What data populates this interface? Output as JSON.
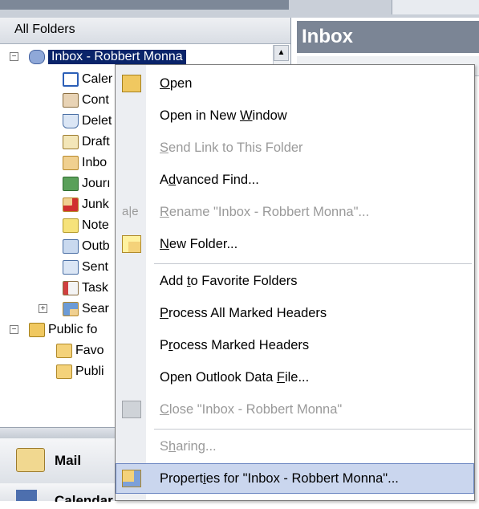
{
  "nav": {
    "header": "All Folders",
    "tree": [
      {
        "label": "Inbox - Robbert Monna",
        "icon": "mailbox-icon",
        "selected": true
      },
      {
        "label": "Calendar",
        "icon": "calendar-icon"
      },
      {
        "label": "Contacts",
        "icon": "contacts-icon"
      },
      {
        "label": "Deleted Items",
        "icon": "deleted-items-icon"
      },
      {
        "label": "Drafts",
        "icon": "drafts-icon"
      },
      {
        "label": "Inbox",
        "icon": "inbox-icon"
      },
      {
        "label": "Journal",
        "icon": "journal-icon"
      },
      {
        "label": "Junk E-mail",
        "icon": "junk-icon"
      },
      {
        "label": "Notes",
        "icon": "notes-icon"
      },
      {
        "label": "Outbox",
        "icon": "outbox-icon"
      },
      {
        "label": "Sent Items",
        "icon": "sent-icon"
      },
      {
        "label": "Tasks",
        "icon": "tasks-icon"
      },
      {
        "label": "Search Folders",
        "icon": "search-folder-icon"
      },
      {
        "label": "Public folders",
        "icon": "public-folders-icon"
      },
      {
        "label": "Favorites",
        "icon": "folder-icon"
      },
      {
        "label": "Public",
        "icon": "folder-icon"
      }
    ],
    "truncated": [
      "Inbox - Robbert Monna",
      "Caler",
      "Cont",
      "Delet",
      "Draft",
      "Inbo",
      "Jourı",
      "Junk",
      "Note",
      "Outb",
      "Sent",
      "Task",
      "Sear",
      "Public fo",
      "Favo",
      "Publi"
    ],
    "mail_button": "Mail",
    "calendar_button": "Calendar"
  },
  "right": {
    "title": "Inbox"
  },
  "context_menu": {
    "items": [
      {
        "label": "Open",
        "mnemonic": "O",
        "icon": "open-folder-icon",
        "enabled": true
      },
      {
        "label": "Open in New Window",
        "mnemonic": "W",
        "enabled": true
      },
      {
        "label": "Send Link to This Folder",
        "mnemonic": "S",
        "enabled": false
      },
      {
        "label": "Advanced Find...",
        "mnemonic": "d",
        "enabled": true
      },
      {
        "label": "Rename \"Inbox - Robbert Monna\"...",
        "mnemonic": "R",
        "icon": "rename-icon",
        "enabled": false
      },
      {
        "label": "New Folder...",
        "mnemonic": "N",
        "icon": "new-folder-icon",
        "enabled": true
      },
      {
        "label": "Add to Favorite Folders",
        "mnemonic": "t",
        "enabled": true
      },
      {
        "label": "Process All Marked Headers",
        "mnemonic": "P",
        "enabled": true
      },
      {
        "label": "Process Marked Headers",
        "mnemonic": "r",
        "enabled": true
      },
      {
        "label": "Open Outlook Data File...",
        "mnemonic": "F",
        "enabled": true
      },
      {
        "label": "Close \"Inbox - Robbert Monna\"",
        "mnemonic": "C",
        "icon": "close-data-file-icon",
        "enabled": false
      },
      {
        "label": "Sharing...",
        "mnemonic": "h",
        "enabled": false
      },
      {
        "label": "Properties for \"Inbox - Robbert Monna\"...",
        "mnemonic": "i",
        "icon": "properties-icon",
        "enabled": true,
        "highlighted": true
      }
    ]
  }
}
